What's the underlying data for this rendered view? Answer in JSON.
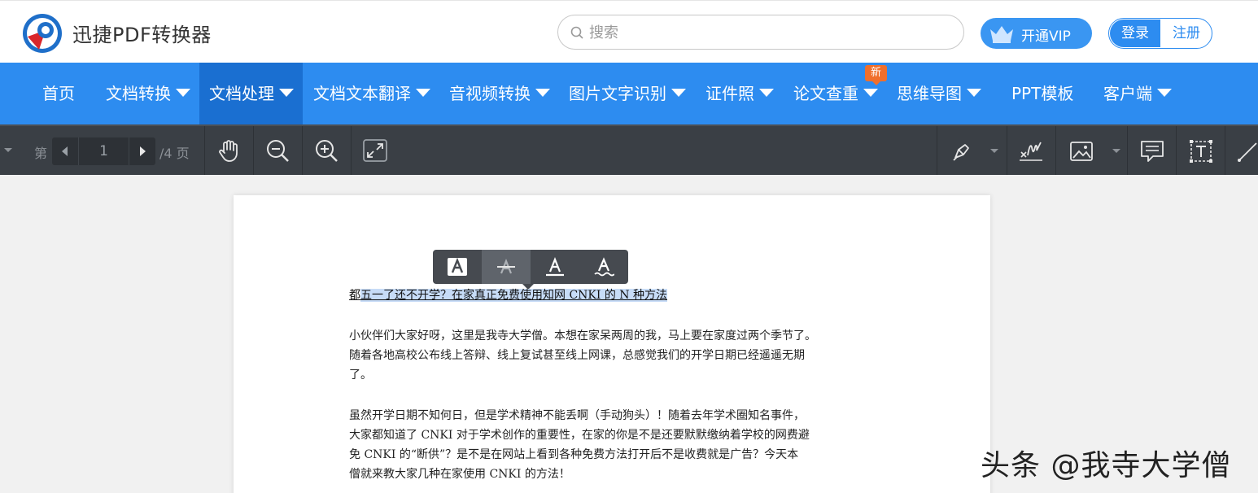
{
  "header": {
    "brand": "迅捷PDF转换器",
    "search_placeholder": "搜索",
    "vip_label": "开通VIP",
    "login_label": "登录",
    "register_label": "注册"
  },
  "nav": {
    "items": [
      {
        "label": "首页"
      },
      {
        "label": "文档转换"
      },
      {
        "label": "文档处理"
      },
      {
        "label": "文档文本翻译"
      },
      {
        "label": "音视频转换"
      },
      {
        "label": "图片文字识别"
      },
      {
        "label": "证件照"
      },
      {
        "label": "论文查重"
      },
      {
        "label": "思维导图"
      },
      {
        "label": "PPT模板"
      },
      {
        "label": "客户端"
      }
    ],
    "new_badge": "新"
  },
  "toolbar": {
    "page_prefix": "第",
    "current_page": "1",
    "page_total": "/4 页"
  },
  "document": {
    "title_first_char": "都",
    "title_rest": "五一了还不开学？在家真正免费使用知网 CNKI 的 N 种方法",
    "para1": [
      "小伙伴们大家好呀，这里是我寺大学僧。本想在家呆两周的我，马上要在家度过两个季节了。",
      "随着各地高校公布线上答辩、线上复试甚至线上网课，总感觉我们的开学日期已经遥遥无期",
      "了。"
    ],
    "para2": [
      "虽然开学日期不知何日，但是学术精神不能丢啊（手动狗头）！随着去年学术圈知名事件，",
      "大家都知道了 CNKI 对于学术创作的重要性，在家的你是不是还要默默缴纳着学校的网费避",
      "免 CNKI 的“断供”？是不是在网站上看到各种免费方法打开后不是收费就是广告？今天本",
      "僧就来教大家几种在家使用 CNKI 的方法！"
    ]
  },
  "watermark": "头条 @我寺大学僧",
  "colors": {
    "nav_bg": "#2d8cf0",
    "nav_active": "#1a6fd1",
    "toolbar_bg": "#3a3f45",
    "badge": "#f06f2c",
    "highlight": "#c7dcf7"
  }
}
